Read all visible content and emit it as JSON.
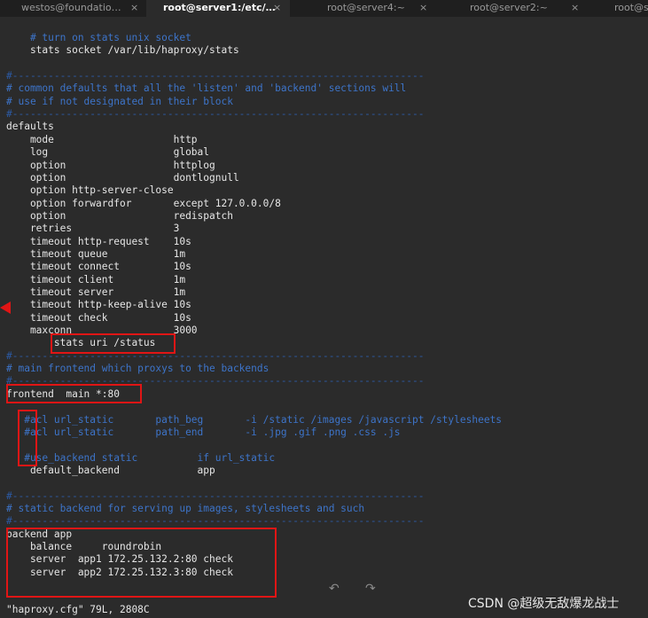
{
  "tabs": [
    {
      "label": "westos@foundatio…",
      "close": "×",
      "active": false
    },
    {
      "label": "root@server1:/etc/…",
      "close": "×",
      "active": true
    },
    {
      "label": "root@server4:~",
      "close": "×",
      "active": false
    },
    {
      "label": "root@server2:~",
      "close": "×",
      "active": false
    },
    {
      "label": "root@s",
      "close": "",
      "active": false
    }
  ],
  "lines": [
    {
      "text": "    # turn on stats unix socket",
      "kind": "cmt"
    },
    {
      "text": "    stats socket /var/lib/haproxy/stats",
      "kind": "code"
    },
    {
      "text": "",
      "kind": "code"
    },
    {
      "text": "#---------------------------------------------------------------------",
      "kind": "dash"
    },
    {
      "text": "# common defaults that all the 'listen' and 'backend' sections will",
      "kind": "cmt"
    },
    {
      "text": "# use if not designated in their block",
      "kind": "cmt"
    },
    {
      "text": "#---------------------------------------------------------------------",
      "kind": "dash"
    },
    {
      "text": "defaults",
      "kind": "code"
    },
    {
      "text": "    mode                    http",
      "kind": "code"
    },
    {
      "text": "    log                     global",
      "kind": "code"
    },
    {
      "text": "    option                  httplog",
      "kind": "code"
    },
    {
      "text": "    option                  dontlognull",
      "kind": "code"
    },
    {
      "text": "    option http-server-close",
      "kind": "code"
    },
    {
      "text": "    option forwardfor       except 127.0.0.0/8",
      "kind": "code"
    },
    {
      "text": "    option                  redispatch",
      "kind": "code"
    },
    {
      "text": "    retries                 3",
      "kind": "code"
    },
    {
      "text": "    timeout http-request    10s",
      "kind": "code"
    },
    {
      "text": "    timeout queue           1m",
      "kind": "code"
    },
    {
      "text": "    timeout connect         10s",
      "kind": "code"
    },
    {
      "text": "    timeout client          1m",
      "kind": "code"
    },
    {
      "text": "    timeout server          1m",
      "kind": "code"
    },
    {
      "text": "    timeout http-keep-alive 10s",
      "kind": "code"
    },
    {
      "text": "    timeout check           10s",
      "kind": "code"
    },
    {
      "text": "    maxconn                 3000",
      "kind": "code"
    },
    {
      "text": "        stats uri /status",
      "kind": "code"
    },
    {
      "text": "#---------------------------------------------------------------------",
      "kind": "dash"
    },
    {
      "text": "# main frontend which proxys to the backends",
      "kind": "cmt"
    },
    {
      "text": "#---------------------------------------------------------------------",
      "kind": "dash"
    },
    {
      "text": "frontend  main *:80",
      "kind": "code"
    },
    {
      "text": "",
      "kind": "code"
    },
    {
      "text": "   #acl url_static       path_beg       -i /static /images /javascript /stylesheets",
      "kind": "cmt"
    },
    {
      "text": "   #acl url_static       path_end       -i .jpg .gif .png .css .js",
      "kind": "cmt"
    },
    {
      "text": "",
      "kind": "code"
    },
    {
      "text": "   #use_backend static          if url_static",
      "kind": "cmt"
    },
    {
      "text": "    default_backend             app",
      "kind": "code"
    },
    {
      "text": "",
      "kind": "code"
    },
    {
      "text": "#---------------------------------------------------------------------",
      "kind": "dash"
    },
    {
      "text": "# static backend for serving up images, stylesheets and such",
      "kind": "cmt"
    },
    {
      "text": "#---------------------------------------------------------------------",
      "kind": "dash"
    },
    {
      "text": "backend app",
      "kind": "code"
    },
    {
      "text": "    balance     roundrobin",
      "kind": "code"
    },
    {
      "text": "    server  app1 172.25.132.2:80 check",
      "kind": "code"
    },
    {
      "text": "    server  app2 172.25.132.3:80 check",
      "kind": "code"
    }
  ],
  "status_line": "\"haproxy.cfg\" 79L, 2808C",
  "nav": {
    "back_icon": "↶",
    "forward_icon": "↷"
  },
  "watermark": "CSDN @超级无敌爆龙战士",
  "colors": {
    "comment": "#3d74c9",
    "highlight_box": "#e01515",
    "background": "#2b2b2b"
  }
}
